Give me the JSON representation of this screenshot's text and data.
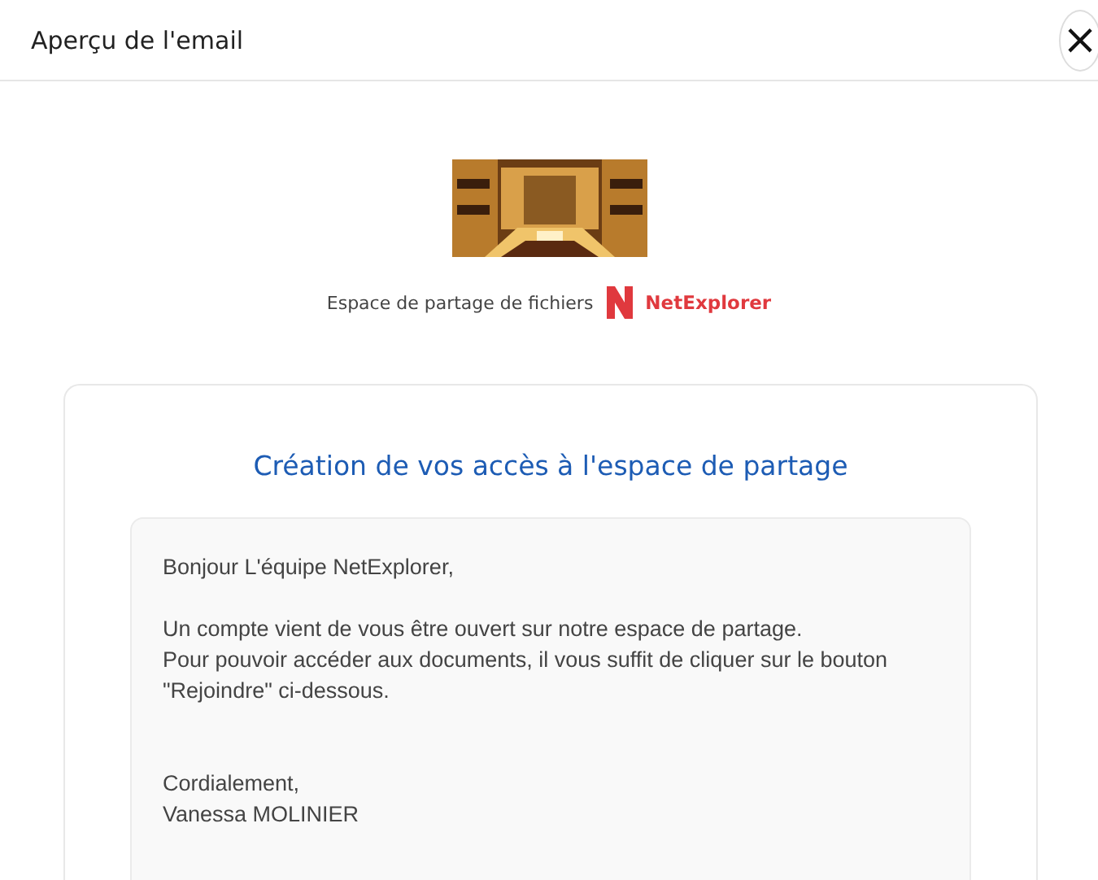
{
  "dialog": {
    "title": "Aperçu de l'email",
    "close_label": "×"
  },
  "email": {
    "banner": {
      "kind": "picture"
    },
    "tagline": "Espace de partage de fichiers",
    "brand": "NetExplorer",
    "heading": "Création de vos accès à l'espace de partage",
    "paragraphs": [
      [
        "Bonjour L'équipe NetExplorer,"
      ],
      [
        "Un compte vient de vous être ouvert sur notre espace de partage.",
        "Pour pouvoir accéder aux documents, il vous suffit de cliquer sur le bouton",
        "\"Rejoindre\" ci-dessous."
      ],
      [
        "Cordialement,",
        "Vanessa MOLINIER"
      ]
    ]
  }
}
